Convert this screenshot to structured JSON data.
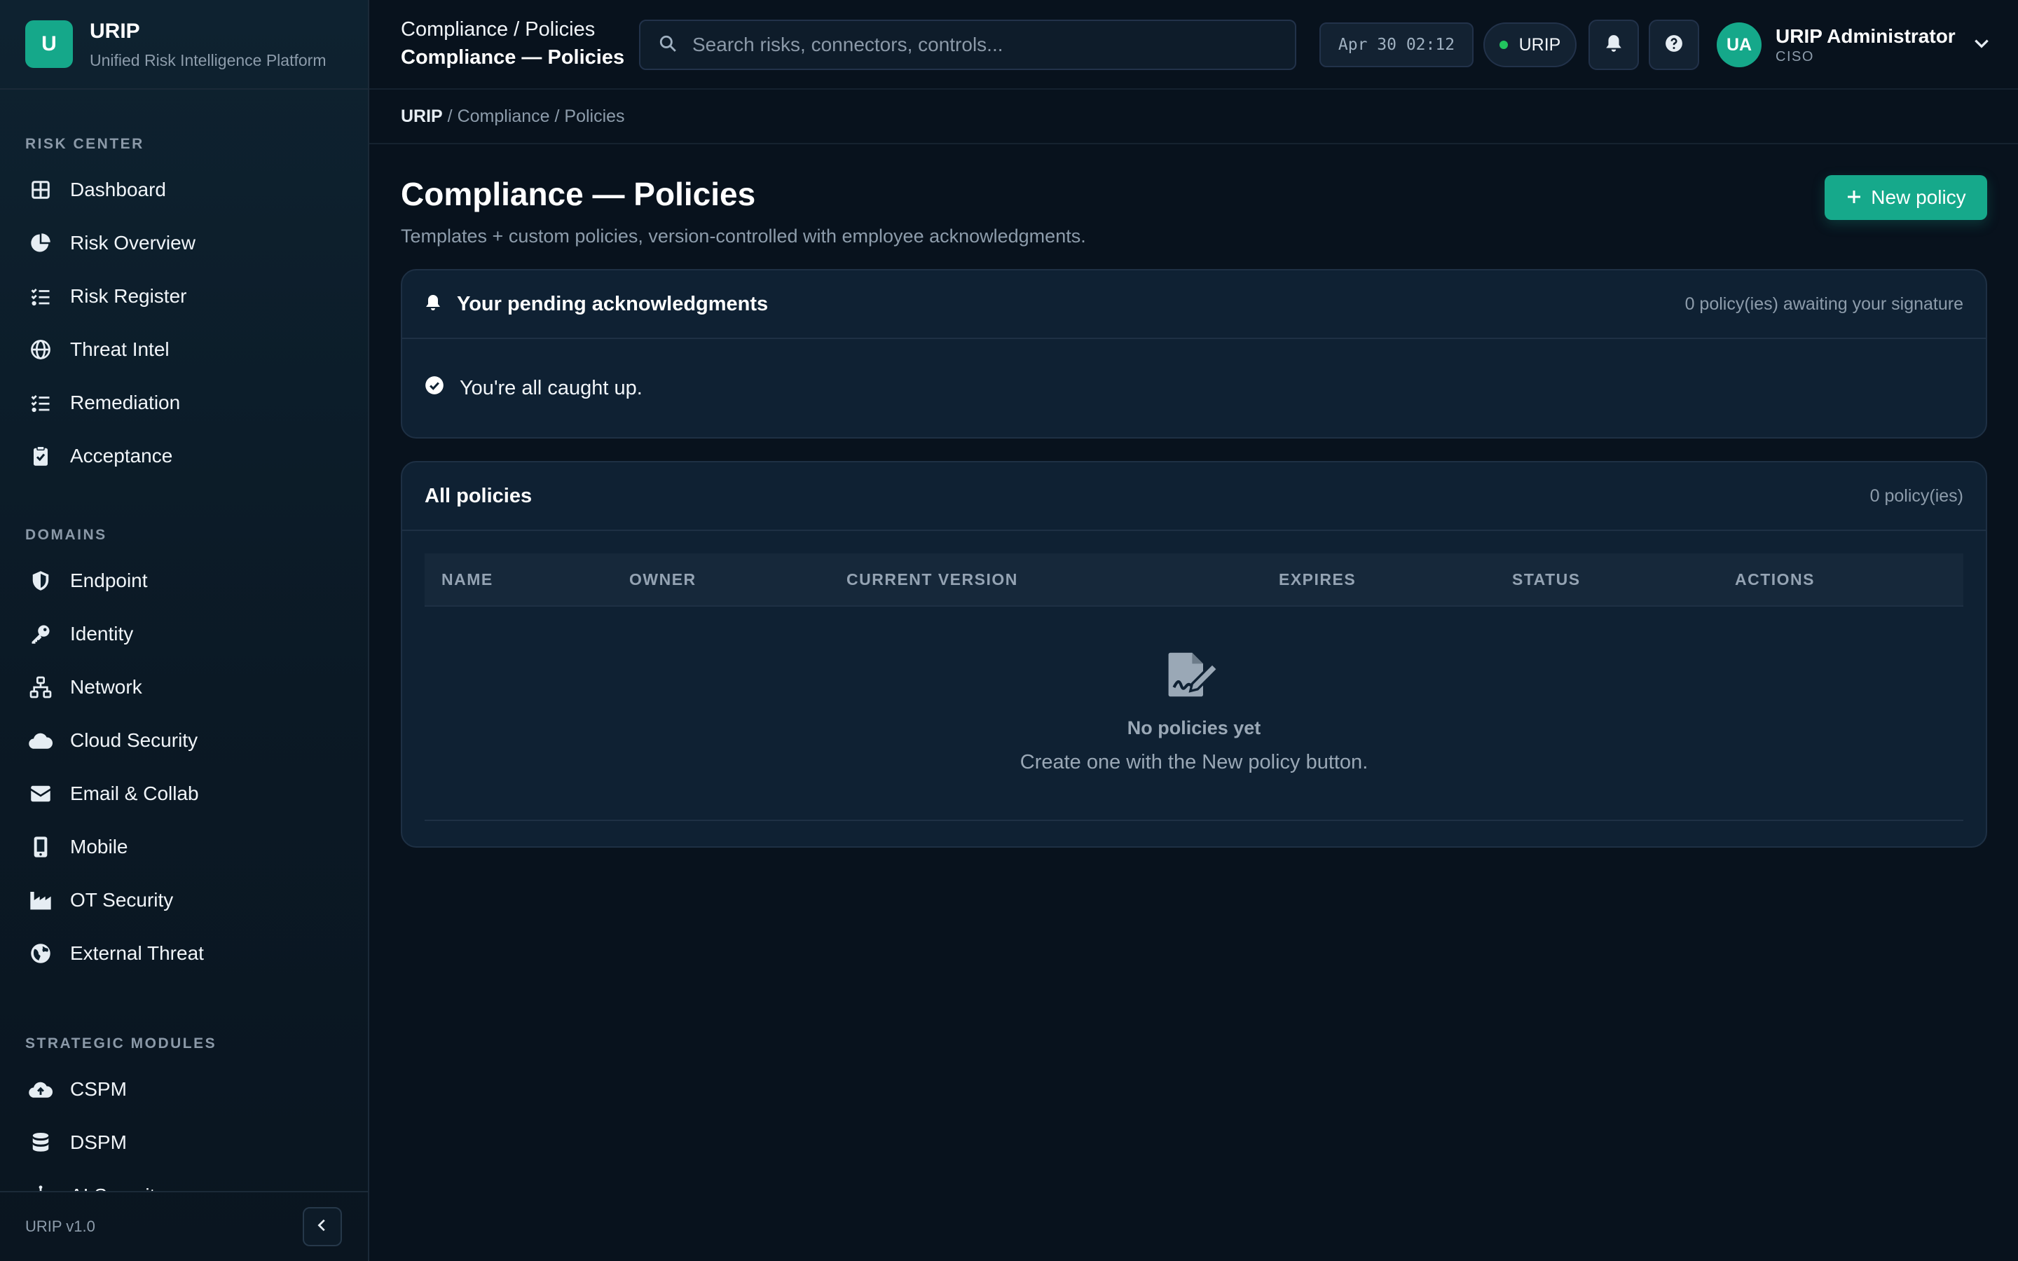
{
  "brand": {
    "logo_letter": "U",
    "name": "URIP",
    "subtitle": "Unified Risk Intelligence Platform"
  },
  "sidebar": {
    "sections": [
      {
        "title": "RISK CENTER",
        "items": [
          {
            "label": "Dashboard",
            "icon": "grid-icon"
          },
          {
            "label": "Risk Overview",
            "icon": "pie-chart-icon"
          },
          {
            "label": "Risk Register",
            "icon": "list-check-icon"
          },
          {
            "label": "Threat Intel",
            "icon": "globe-icon"
          },
          {
            "label": "Remediation",
            "icon": "list-check-icon"
          },
          {
            "label": "Acceptance",
            "icon": "clipboard-check-icon"
          }
        ]
      },
      {
        "title": "DOMAINS",
        "items": [
          {
            "label": "Endpoint",
            "icon": "shield-icon"
          },
          {
            "label": "Identity",
            "icon": "key-icon"
          },
          {
            "label": "Network",
            "icon": "network-icon"
          },
          {
            "label": "Cloud Security",
            "icon": "cloud-icon"
          },
          {
            "label": "Email & Collab",
            "icon": "envelope-icon"
          },
          {
            "label": "Mobile",
            "icon": "mobile-icon"
          },
          {
            "label": "OT Security",
            "icon": "industry-icon"
          },
          {
            "label": "External Threat",
            "icon": "earth-icon"
          }
        ]
      },
      {
        "title": "STRATEGIC MODULES",
        "items": [
          {
            "label": "CSPM",
            "icon": "cloud-upload-icon"
          },
          {
            "label": "DSPM",
            "icon": "database-icon"
          },
          {
            "label": "AI Security",
            "icon": "robot-icon"
          }
        ]
      }
    ],
    "version": "URIP v1.0"
  },
  "topbar": {
    "crumb": "Compliance / Policies",
    "title": "Compliance — Policies",
    "search_placeholder": "Search risks, connectors, controls...",
    "clock": "Apr 30 02:12",
    "tenant": "URIP",
    "user": {
      "initials": "UA",
      "name": "URIP Administrator",
      "role": "CISO"
    }
  },
  "breadcrumb": {
    "root": "URIP",
    "rest": " / Compliance / Policies"
  },
  "page": {
    "title": "Compliance — Policies",
    "subtitle": "Templates + custom policies, version-controlled with employee acknowledgments.",
    "new_button": "New policy"
  },
  "pending": {
    "title": "Your pending acknowledgments",
    "meta": "0 policy(ies) awaiting your signature",
    "empty": "You're all caught up."
  },
  "policies": {
    "title": "All policies",
    "meta": "0 policy(ies)",
    "columns": [
      "NAME",
      "OWNER",
      "CURRENT VERSION",
      "EXPIRES",
      "STATUS",
      "ACTIONS"
    ],
    "empty_title": "No policies yet",
    "empty_sub": "Create one with the New policy button."
  },
  "colors": {
    "accent": "#16a98b",
    "bg": "#08121d",
    "card": "#0f2133",
    "online": "#22c55e"
  }
}
